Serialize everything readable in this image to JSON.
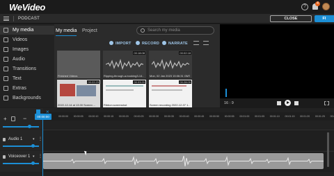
{
  "app": {
    "logo": "WeVideo",
    "project_title": "PODCAST"
  },
  "header": {
    "help": "?",
    "notifications": "4",
    "close": "CLOSE",
    "finish": "FI"
  },
  "sidebar": {
    "items": [
      {
        "label": "My media",
        "icon": "folder-icon",
        "active": true
      },
      {
        "label": "Videos",
        "icon": "film-icon"
      },
      {
        "label": "Images",
        "icon": "image-icon"
      },
      {
        "label": "Audio",
        "icon": "music-icon"
      },
      {
        "label": "Transitions",
        "icon": "transition-icon"
      },
      {
        "label": "Text",
        "icon": "text-icon"
      },
      {
        "label": "Extras",
        "icon": "sparkle-icon"
      },
      {
        "label": "Backgrounds",
        "icon": "backgrounds-icon"
      }
    ]
  },
  "media": {
    "tabs": [
      "My media",
      "Project"
    ],
    "search_placeholder": "Search my media",
    "actions": {
      "import": "IMPORT",
      "record": "RECORD",
      "narrate": "NARRATE"
    },
    "items": [
      {
        "type": "folder",
        "caption": "Finished Videos",
        "duration": ""
      },
      {
        "type": "audio",
        "caption": "Ripping-through-a-booking3-14...",
        "duration": "00:18:08"
      },
      {
        "type": "audio",
        "caption": "Mon, 02 Jan 2023 15:06:31 GMT",
        "duration": "00:02:18"
      },
      {
        "type": "video",
        "caption": "2022-12-14 at 13.00 Screen ...",
        "duration": "00:22:23"
      },
      {
        "type": "video",
        "caption": "Ribbon.screenshot",
        "duration": "00:33:20"
      },
      {
        "type": "video",
        "caption": "Screen recording 2022-12-07 1...",
        "duration": "00:28:09"
      }
    ]
  },
  "preview": {
    "ratio": "16 : 9"
  },
  "timeline": {
    "playhead": "00:00:00",
    "ticks": [
      "00:00:00",
      "00:00:05",
      "00:00:10",
      "00:00:15",
      "00:00:20",
      "00:00:25",
      "00:00:30",
      "00:00:35",
      "00:00:40",
      "00:00:45",
      "00:00:50",
      "00:00:55",
      "00:01:00",
      "00:01:05",
      "00:01:10",
      "00:01:15",
      "00:01:20",
      "00:01:25",
      "00:01:30"
    ],
    "tracks": [
      {
        "name": "Audio 1",
        "type": "audio"
      },
      {
        "name": "Voiceover 1",
        "type": "voiceover"
      }
    ]
  },
  "colors": {
    "accent": "#1c8fd6",
    "orange": "#e8661e"
  }
}
